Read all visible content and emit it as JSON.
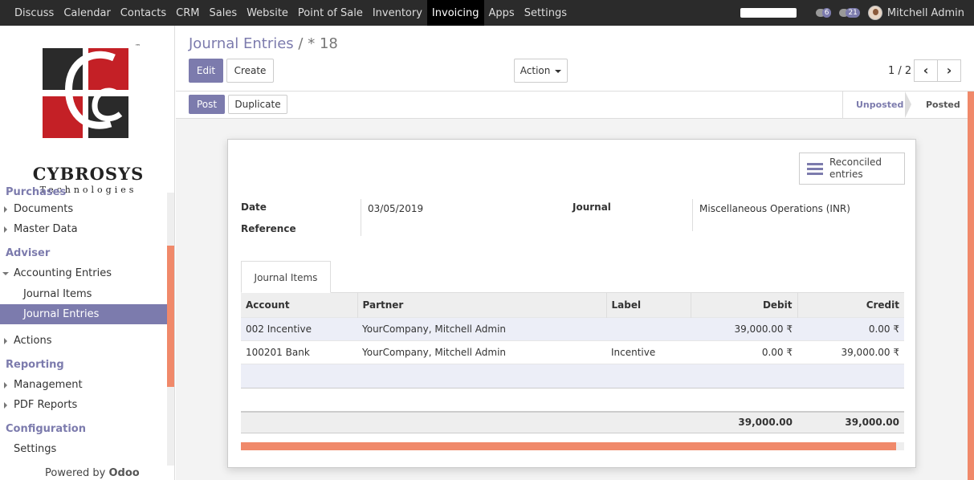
{
  "topbar": {
    "menu": [
      "Discuss",
      "Calendar",
      "Contacts",
      "CRM",
      "Sales",
      "Website",
      "Point of Sale",
      "Inventory",
      "Invoicing",
      "Apps",
      "Settings"
    ],
    "active": "Invoicing",
    "messages_count": "6",
    "activities_count": "21",
    "user": "Mitchell Admin"
  },
  "logo": {
    "brand": "CYBROSYS",
    "tagline": "Technologies",
    "trademark": "™"
  },
  "sidebar": {
    "s0": "Purchases",
    "i0": "Documents",
    "i1": "Master Data",
    "s1": "Adviser",
    "i2": "Accounting Entries",
    "i3": "Journal Items",
    "i4": "Journal Entries",
    "i5": "Actions",
    "s2": "Reporting",
    "i6": "Management",
    "i7": "PDF Reports",
    "s3": "Configuration",
    "i8": "Settings",
    "powered_prefix": "Powered by",
    "powered_brand": "Odoo"
  },
  "control": {
    "breadcrumb_parent": "Journal Entries",
    "breadcrumb_sep": "/",
    "breadcrumb_current": "* 18",
    "edit": "Edit",
    "create": "Create",
    "action": "Action",
    "pager": "1 / 2"
  },
  "statusbar": {
    "post": "Post",
    "duplicate": "Duplicate",
    "unposted": "Unposted",
    "posted": "Posted"
  },
  "form": {
    "stat_button": [
      "Reconciled",
      "entries"
    ],
    "date_label": "Date",
    "date_value": "03/05/2019",
    "reference_label": "Reference",
    "journal_label": "Journal",
    "journal_value": "Miscellaneous Operations (INR)",
    "tab": "Journal Items",
    "columns": [
      "Account",
      "Partner",
      "Label",
      "Debit",
      "Credit"
    ],
    "rows": [
      {
        "account": "002 Incentive",
        "partner": "YourCompany, Mitchell Admin",
        "label": "",
        "debit": "39,000.00 ₹",
        "credit": "0.00 ₹"
      },
      {
        "account": "100201 Bank",
        "partner": "YourCompany, Mitchell Admin",
        "label": "Incentive",
        "debit": "0.00 ₹",
        "credit": "39,000.00 ₹"
      }
    ],
    "total_debit": "39,000.00",
    "total_credit": "39,000.00"
  }
}
